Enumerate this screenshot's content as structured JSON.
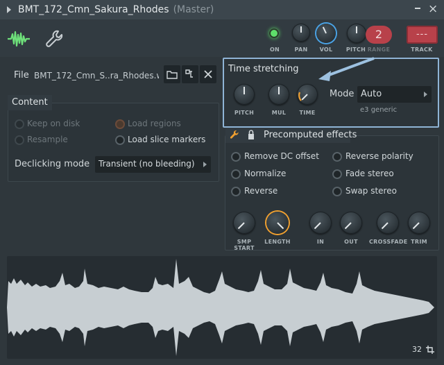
{
  "window": {
    "title": "BMT_172_Cmn_Sakura_Rhodes",
    "subtitle": "(Master)",
    "menu_icon": "minus-bar-icon",
    "close_label": "×"
  },
  "header": {
    "wave_icon": "waveform-icon",
    "wrench_icon": "wrench-icon",
    "on_label": "ON",
    "pan_label": "PAN",
    "vol_label": "VOL",
    "pitch_label": "PITCH",
    "range_label": "RANGE",
    "range_value": "2",
    "track_label": "TRACK",
    "track_value": "---",
    "accent_color": "#4aa3e6",
    "led_color": "#5ee06a"
  },
  "file": {
    "label": "File",
    "name": "BMT_172_Cmn_S..ra_Rhodes.wav"
  },
  "content": {
    "title": "Content",
    "keep_on_disk": "Keep on disk",
    "load_regions": "Load regions",
    "resample": "Resample",
    "load_slice_markers": "Load slice markers",
    "declicking_label": "Declicking mode",
    "declicking_value": "Transient (no bleeding)"
  },
  "time_stretching": {
    "title": "Time stretching",
    "pitch_label": "PITCH",
    "mul_label": "MUL",
    "time_label": "TIME",
    "mode_label": "Mode",
    "mode_value": "Auto",
    "mode_sub": "e3 generic",
    "highlight_color": "#8fb4d6"
  },
  "precomputed": {
    "title": "Precomputed effects",
    "remove_dc": "Remove DC offset",
    "reverse_polarity": "Reverse polarity",
    "normalize": "Normalize",
    "fade_stereo": "Fade stereo",
    "reverse": "Reverse",
    "swap_stereo": "Swap stereo",
    "smp_start": "SMP START",
    "length": "LENGTH",
    "in": "IN",
    "out": "OUT",
    "crossfade": "CROSSFADE",
    "trim": "TRIM",
    "orange_color": "#f0a030"
  },
  "waveform": {
    "zoom_value": "32",
    "zoom_icon": "crop-icon"
  }
}
